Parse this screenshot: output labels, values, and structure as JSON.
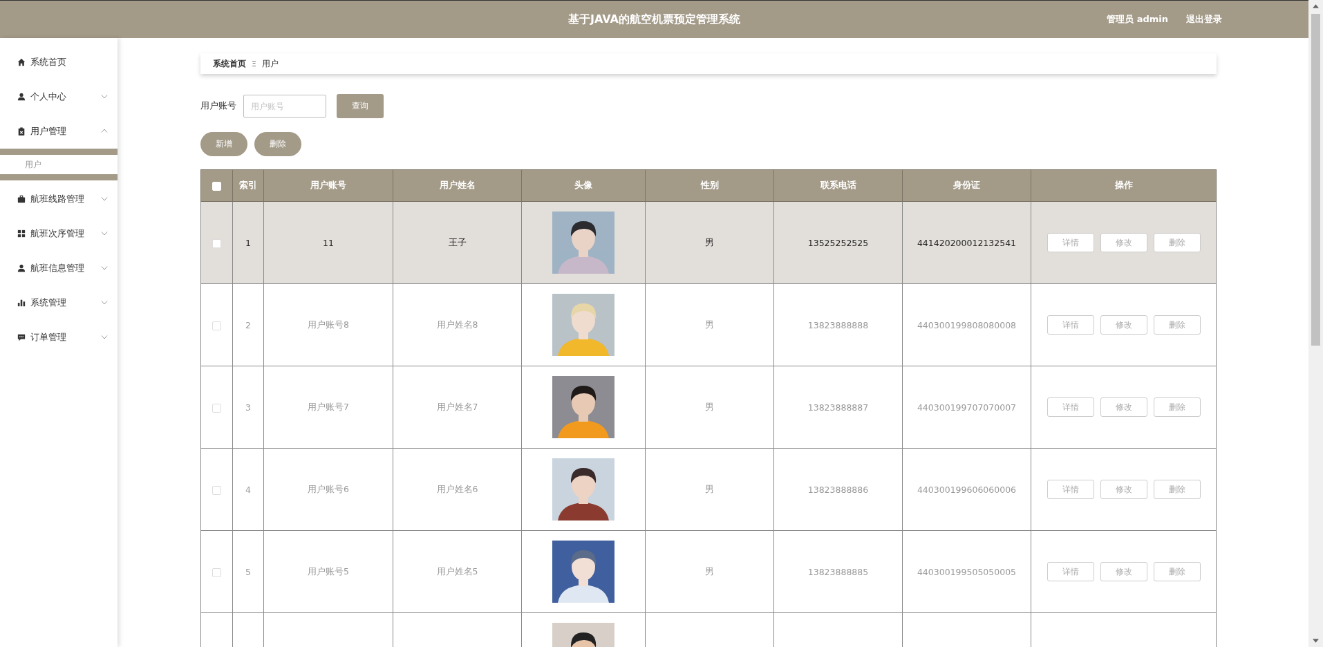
{
  "header": {
    "title": "基于JAVA的航空机票预定管理系统",
    "user": "管理员 admin",
    "logout": "退出登录"
  },
  "sidebar": {
    "items": [
      {
        "label": "系统首页",
        "kind": "link"
      },
      {
        "label": "个人中心",
        "kind": "menu",
        "expanded": false
      },
      {
        "label": "用户管理",
        "kind": "menu",
        "expanded": true,
        "children": [
          {
            "label": "用户",
            "selected": true
          }
        ]
      },
      {
        "label": "航班线路管理",
        "kind": "menu",
        "expanded": false
      },
      {
        "label": "航班次序管理",
        "kind": "menu",
        "expanded": false
      },
      {
        "label": "航班信息管理",
        "kind": "menu",
        "expanded": false
      },
      {
        "label": "系统管理",
        "kind": "menu",
        "expanded": false
      },
      {
        "label": "订单管理",
        "kind": "menu",
        "expanded": false
      }
    ]
  },
  "breadcrumb": {
    "items": [
      "系统首页",
      "用户"
    ],
    "separator": "Ξ"
  },
  "search": {
    "label": "用户账号",
    "placeholder": "用户账号",
    "button": "查询"
  },
  "actions": [
    "新增",
    "删除"
  ],
  "table": {
    "header_checked": false,
    "columns": [
      "索引",
      "用户账号",
      "用户姓名",
      "头像",
      "性别",
      "联系电话",
      "身份证",
      "操作"
    ],
    "rows": [
      {
        "checked": false,
        "hovered": true,
        "index": "1",
        "account": "11",
        "name": "王子",
        "avatar": {
          "kind": "picture"
        },
        "gender": "男",
        "phone": "13525252525",
        "id_card": "441420200012132541",
        "buttons": [
          "详情",
          "修改",
          "删除"
        ]
      },
      {
        "checked": false,
        "hovered": false,
        "index": "2",
        "account": "用户账号8",
        "name": "用户姓名8",
        "avatar": {
          "kind": "picture"
        },
        "gender": "男",
        "phone": "13823888888",
        "id_card": "440300199808080008",
        "buttons": [
          "详情",
          "修改",
          "删除"
        ]
      },
      {
        "checked": false,
        "hovered": false,
        "index": "3",
        "account": "用户账号7",
        "name": "用户姓名7",
        "avatar": {
          "kind": "picture"
        },
        "gender": "男",
        "phone": "13823888887",
        "id_card": "440300199707070007",
        "buttons": [
          "详情",
          "修改",
          "删除"
        ]
      },
      {
        "checked": false,
        "hovered": false,
        "index": "4",
        "account": "用户账号6",
        "name": "用户姓名6",
        "avatar": {
          "kind": "picture"
        },
        "gender": "男",
        "phone": "13823888886",
        "id_card": "440300199606060006",
        "buttons": [
          "详情",
          "修改",
          "删除"
        ]
      },
      {
        "checked": false,
        "hovered": false,
        "index": "5",
        "account": "用户账号5",
        "name": "用户姓名5",
        "avatar": {
          "kind": "picture"
        },
        "gender": "男",
        "phone": "13823888885",
        "id_card": "440300199505050005",
        "buttons": [
          "详情",
          "修改",
          "删除"
        ]
      },
      {
        "avatar": {
          "kind": "picture"
        }
      }
    ]
  }
}
